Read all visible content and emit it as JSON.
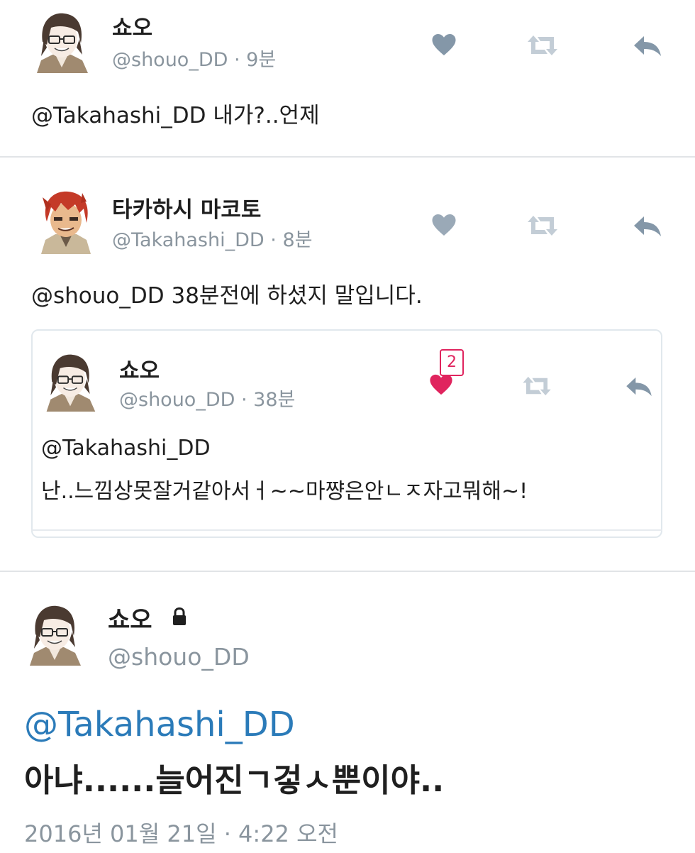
{
  "tweet1": {
    "name": "쇼오",
    "handle": "@shouo_DD",
    "time": " · 9분",
    "text": "@Takahashi_DD 내가?..언제"
  },
  "tweet2": {
    "name": "타카하시 마코토",
    "handle": "@Takahashi_DD",
    "time": " · 8분",
    "text": "@shouo_DD 38분전에 하셨지 말입니다."
  },
  "quoted": {
    "name": "쇼오",
    "handle": "@shouo_DD",
    "time": " · 38분",
    "like_count": "2",
    "line1": "@Takahashi_DD",
    "line2": "난..느낌상못잘거같아서ㅓ~~마쨩은안ㄴㅈ자고뭐해~!"
  },
  "detail": {
    "name": "쇼오",
    "handle": "@shouo_DD",
    "mention": "@Takahashi_DD",
    "text": "아냐......늘어진ㄱ겋ㅅ뿐이야..",
    "timestamp": "2016년 01월 21일 · 4:22 오전"
  },
  "colors": {
    "icon_gray": "#8a98a6",
    "like_red": "#e0245e",
    "mention_blue": "#2b7bb9"
  },
  "icons": {
    "like": "heart-icon",
    "retweet": "retweet-icon",
    "reply": "reply-icon",
    "lock": "lock-icon"
  }
}
